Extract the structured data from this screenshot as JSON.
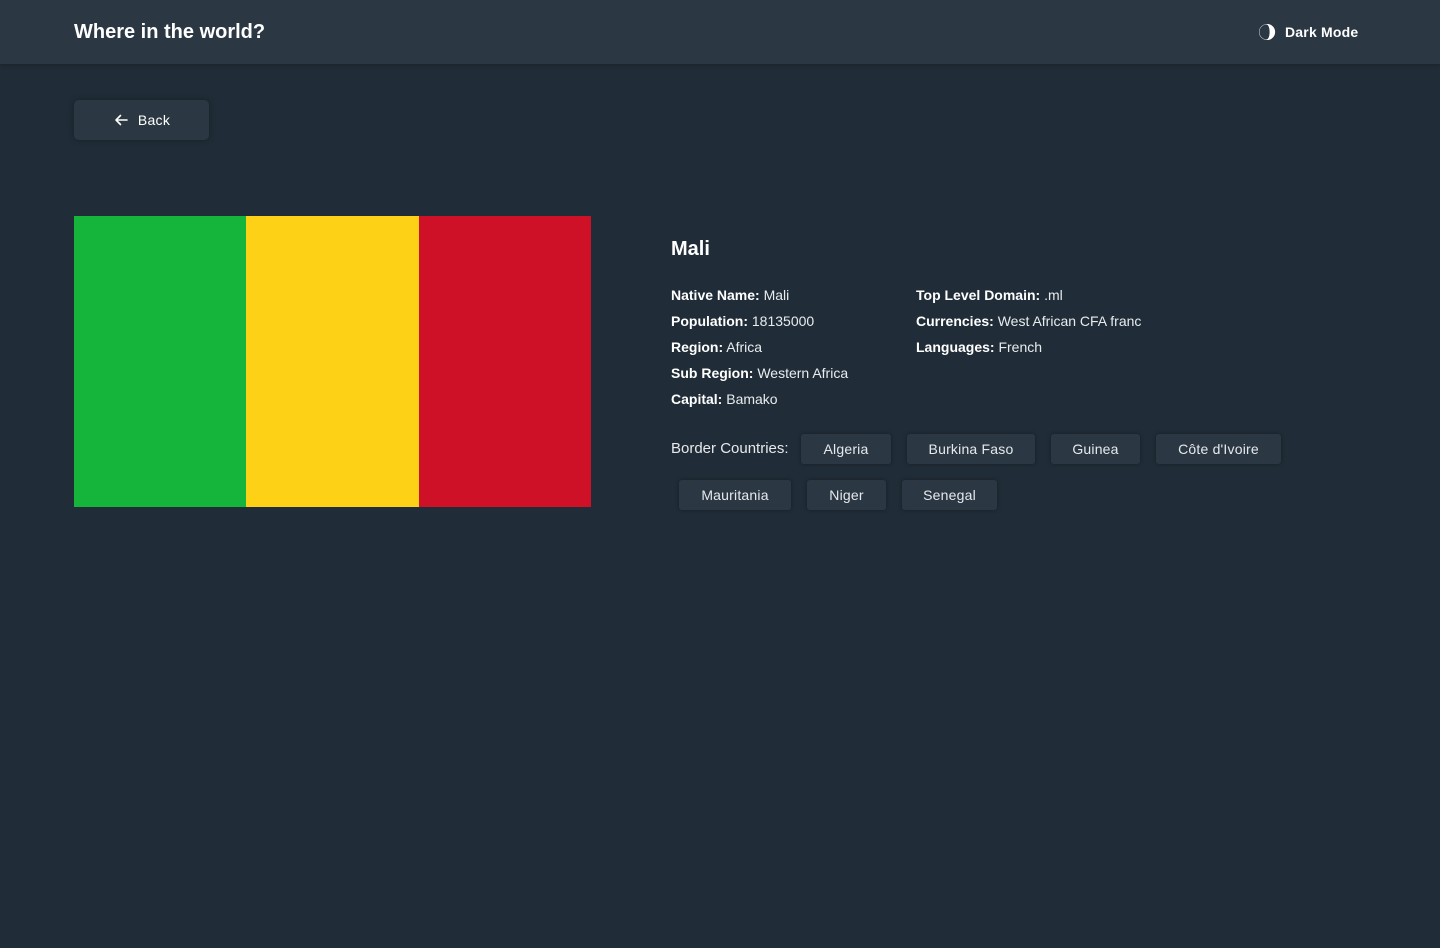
{
  "header": {
    "title": "Where in the world?",
    "theme_toggle_label": "Dark Mode"
  },
  "back_button": {
    "label": "Back"
  },
  "country": {
    "name": "Mali",
    "flag_colors": [
      "#14b53a",
      "#fcd116",
      "#ce1126"
    ],
    "details_left": [
      {
        "label": "Native Name:",
        "value": "Mali"
      },
      {
        "label": "Population:",
        "value": "18135000"
      },
      {
        "label": "Region:",
        "value": "Africa"
      },
      {
        "label": "Sub Region:",
        "value": "Western Africa"
      },
      {
        "label": "Capital:",
        "value": "Bamako"
      }
    ],
    "details_right": [
      {
        "label": "Top Level Domain:",
        "value": ".ml"
      },
      {
        "label": "Currencies:",
        "value": "West African CFA franc"
      },
      {
        "label": "Languages:",
        "value": "French"
      }
    ],
    "border_countries_label": "Border Countries:",
    "border_countries": [
      "Algeria",
      "Burkina Faso",
      "Guinea",
      "Côte d'Ivoire",
      "Mauritania",
      "Niger",
      "Senegal"
    ]
  },
  "colors": {
    "background": "#202c37",
    "element": "#2b3844",
    "text": "#ffffff"
  },
  "icons": {
    "theme": "moon-icon",
    "back": "arrow-left-icon"
  }
}
